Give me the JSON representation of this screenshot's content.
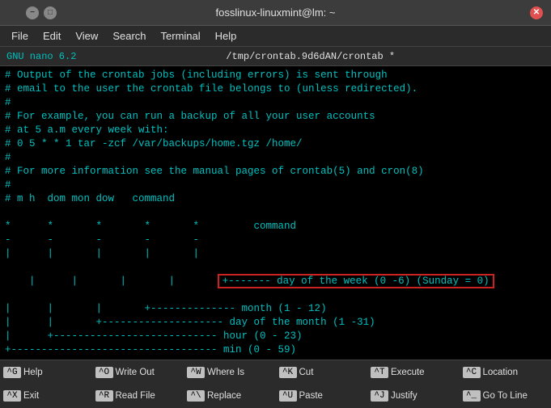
{
  "titlebar": {
    "title": "fosslinux-linuxmint@lm: ~",
    "minimize": "−",
    "maximize": "□",
    "close": "✕"
  },
  "menubar": {
    "items": [
      "File",
      "Edit",
      "View",
      "Search",
      "Terminal",
      "Help"
    ]
  },
  "nano": {
    "version": "GNU nano 6.2",
    "filename": "/tmp/crontab.9d6dAN/crontab *"
  },
  "editor": {
    "lines": [
      "# Output of the crontab jobs (including errors) is sent through",
      "# email to the user the crontab file belongs to (unless redirected).",
      "#",
      "# For example, you can run a backup of all your user accounts",
      "# at 5 a.m every week with:",
      "# 0 5 * * 1 tar -zcf /var/backups/home.tgz /home/",
      "#",
      "# For more information see the manual pages of crontab(5) and cron(8)",
      "#",
      "# m h  dom mon dow   command",
      "",
      "*      *       *       *       *         command",
      "-      -       -       -       -",
      "|      |       |       |       |",
      "|      |       |       |       +------- day of the week (0 -6) (Sunday = 0)",
      "|      |       |       +-------------- month (1 - 12)",
      "|      |       +-------------------- day of the month (1 -31)",
      "|      +--------------------------- hour (0 - 23)",
      "+---------------------------------- min (0 - 59)"
    ]
  },
  "bottombar": {
    "commands": [
      {
        "key": "^G",
        "label": "Help"
      },
      {
        "key": "^O",
        "label": "Write Out"
      },
      {
        "key": "^W",
        "label": "Where Is"
      },
      {
        "key": "^K",
        "label": "Cut"
      },
      {
        "key": "^T",
        "label": "Execute"
      },
      {
        "key": "^C",
        "label": "Location"
      },
      {
        "key": "^X",
        "label": "Exit"
      },
      {
        "key": "^R",
        "label": "Read File"
      },
      {
        "key": "^\\",
        "label": "Replace"
      },
      {
        "key": "^U",
        "label": "Paste"
      },
      {
        "key": "^J",
        "label": "Justify"
      },
      {
        "key": "^_",
        "label": "Go To Line"
      }
    ]
  }
}
